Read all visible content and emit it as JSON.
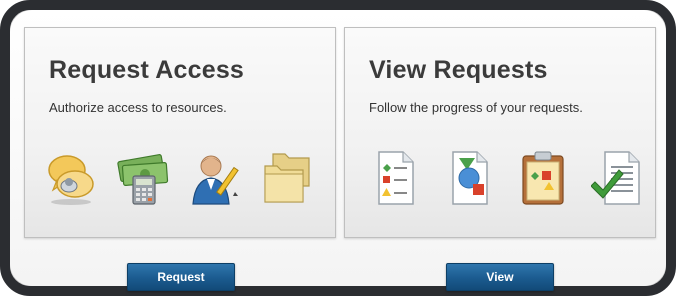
{
  "request_panel": {
    "title": "Request Access",
    "subtitle": "Authorize access to resources.",
    "icons": [
      "chat-bubbles-icon",
      "money-calculator-icon",
      "user-pencil-icon",
      "folders-icon"
    ]
  },
  "view_panel": {
    "title": "View Requests",
    "subtitle": "Follow the progress of your requests.",
    "icons": [
      "document-list-icon",
      "document-shapes-icon",
      "clipboard-icon",
      "document-check-icon"
    ]
  },
  "buttons": {
    "request_label": "Request",
    "view_label": "View"
  },
  "colors": {
    "button_blue": "#1b5b8f",
    "frame": "#2b2d31"
  }
}
